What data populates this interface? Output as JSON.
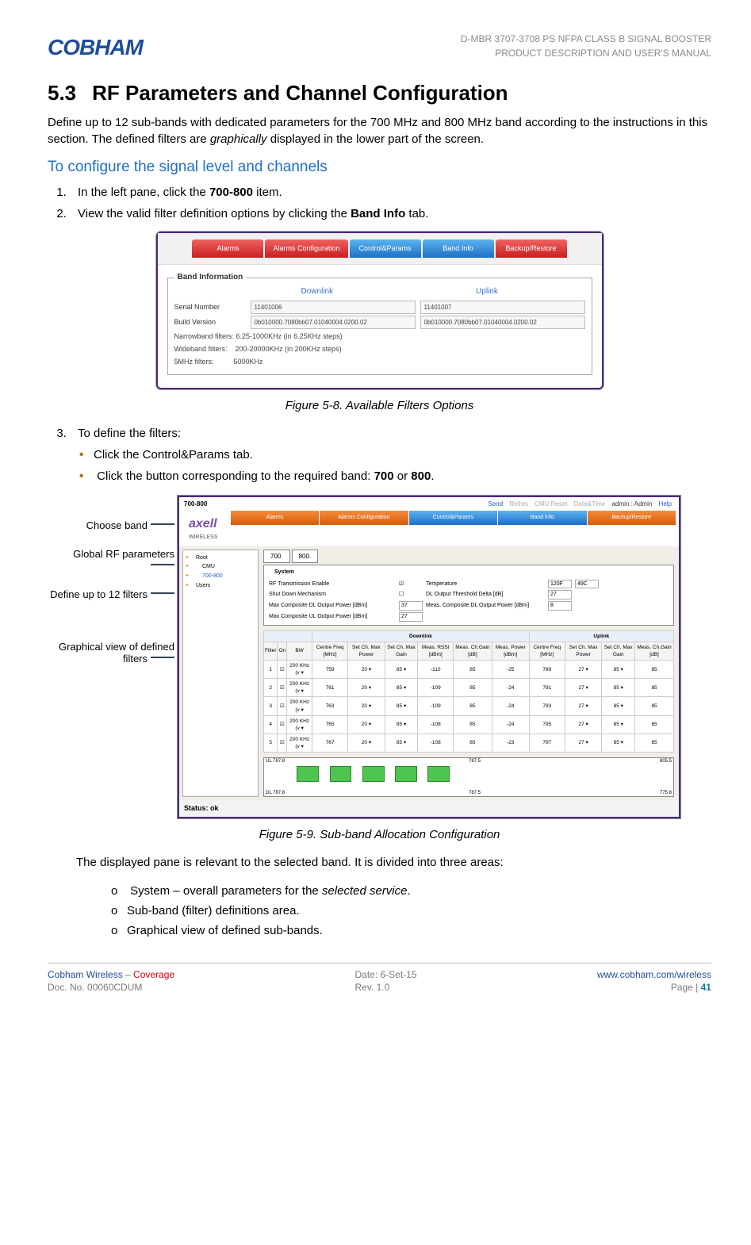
{
  "logo_text": "COBHAM",
  "header_right": {
    "line1": "D-MBR 3707-3708 PS NFPA CLASS B SIGNAL BOOSTER",
    "line2": "PRODUCT DESCRIPTION AND USER'S MANUAL"
  },
  "section": {
    "number": "5.3",
    "title": "RF Parameters and Channel Configuration"
  },
  "intro_before": "Define up to 12 sub-bands with dedicated parameters for the 700 MHz and 800 MHz band according to the instructions in this section. The defined filters are ",
  "intro_italic": "graphically",
  "intro_after": " displayed in the lower part of the screen.",
  "subhead": "To configure the signal level and channels",
  "steps": {
    "s1a": "In the left pane, click the ",
    "s1b": "700-800",
    "s1c": " item.",
    "s2a": "View the valid filter definition options by clicking the ",
    "s2b": "Band Info",
    "s2c": " tab.",
    "s3": "To define the filters:"
  },
  "fig1_caption": "Figure 5-8. Available Filters Options",
  "ui1": {
    "tabs": {
      "alarms": "Alarms",
      "alarms_cfg": "Alarms Configuration",
      "ctrl": "Control&Params",
      "band": "Band Info",
      "backup": "Backup/Restore"
    },
    "panel_title": "Band Information",
    "dl": "Downlink",
    "ul": "Uplink",
    "serial_label": "Serial Number",
    "serial_dl": "11401006",
    "serial_ul": "11401007",
    "build_label": "Build Version",
    "build_dl": "0b010000.7080bb07.01040004.0200.02",
    "build_ul": "0b010000.7080bb07.01040004.0200.02",
    "note1": "Narrowband filters: 6.25-1000KHz (in 6.25KHz steps)",
    "note2": "Wideband filters:    200-20000KHz (in 200KHz steps)",
    "note3": "5MHz filters:          5000KHz"
  },
  "bullets": {
    "b1": "Click the Control&Params tab.",
    "b2a": "Click the button corresponding to the required band: ",
    "b2b": "700",
    "b2or": " or ",
    "b2c": "800",
    "b2d": "."
  },
  "callouts": {
    "c1": "Choose band",
    "c2": "Global RF parameters",
    "c3": "Define up to 12 filters",
    "c4": "Graphical view of defined filters"
  },
  "ui2": {
    "title": "700-800",
    "menu": {
      "send": "Send",
      "refres": "Refres",
      "cmu": "CMU Reset",
      "dt": "Date&Time",
      "admin": "admin : Admin",
      "help": "Help"
    },
    "brand": "axell",
    "tabs": {
      "alarms": "Alarms",
      "alarms_cfg": "Alarms Configuration",
      "ctrl": "Control&Params",
      "band": "Band Info",
      "backup": "Backup/Restore"
    },
    "tree": {
      "root": "Root",
      "cmu": "CMU",
      "band": "700-800",
      "users": "Users"
    },
    "band_tabs": {
      "t700": "700.",
      "t800": "800."
    },
    "system": {
      "legend": "System",
      "rf_en": "RF Transmission Enable",
      "sd": "Shut Down Mechanism",
      "maxdl": "Max Composite DL Output Power [dBm]",
      "maxdl_v": "37",
      "maxul": "Max Composite UL Output Power [dBm]",
      "maxul_v": "27",
      "temp": "Temperature",
      "temp_f": "120F",
      "temp_c": "49C",
      "dlth": "DL Output Threshold Delta [dB]",
      "dlth_v": "27",
      "meas": "Meas. Composite DL Output Power [dBm]",
      "meas_v": "8"
    },
    "table": {
      "dl": "Downlink",
      "ul": "Uplink",
      "h_filter": "Filter",
      "h_on": "On",
      "h_bw": "BW",
      "h_cf": "Centre Freq [MHz]",
      "h_smp": "Set Ch. Max Power",
      "h_smg": "Set Ch. Max Gain",
      "h_rssi": "Meas. RSSI [dBm]",
      "h_mcg": "Meas. Ch.Gain [dB]",
      "h_mpw": "Meas. Power [dBm]",
      "h_cf2": "Centre Freq [MHz]",
      "h_smp2": "Set Ch. Max Power",
      "h_smg2": "Set Ch. Max Gain",
      "h_mcg2": "Meas. Ch.Gain [dB]",
      "rows": [
        {
          "n": "1",
          "bw": "200 KHz (v",
          "cf": "759",
          "smp": "20",
          "smg": "85",
          "rssi": "-110",
          "mcg": "85",
          "mpw": "-25",
          "cf2": "789",
          "smp2": "27",
          "smg2": "85",
          "mcg2": "85"
        },
        {
          "n": "2",
          "bw": "200 KHz (v",
          "cf": "761",
          "smp": "20",
          "smg": "85",
          "rssi": "-109",
          "mcg": "85",
          "mpw": "-24",
          "cf2": "791",
          "smp2": "27",
          "smg2": "85",
          "mcg2": "85"
        },
        {
          "n": "3",
          "bw": "200 KHz (v",
          "cf": "763",
          "smp": "20",
          "smg": "85",
          "rssi": "-109",
          "mcg": "85",
          "mpw": "-24",
          "cf2": "793",
          "smp2": "27",
          "smg2": "85",
          "mcg2": "85"
        },
        {
          "n": "4",
          "bw": "200 KHz (v",
          "cf": "765",
          "smp": "20",
          "smg": "85",
          "rssi": "-108",
          "mcg": "85",
          "mpw": "-24",
          "cf2": "795",
          "smp2": "27",
          "smg2": "85",
          "mcg2": "85"
        },
        {
          "n": "5",
          "bw": "200 KHz (v",
          "cf": "767",
          "smp": "20",
          "smg": "85",
          "rssi": "-108",
          "mcg": "85",
          "mpw": "-23",
          "cf2": "797",
          "smp2": "27",
          "smg2": "85",
          "mcg2": "85"
        }
      ],
      "ul_left": "UL 787.8",
      "ul_mid": "787.5",
      "ul_right": "805.5",
      "dl_left": "DL 787.8",
      "dl_mid": "787.5",
      "dl_right": "775.8"
    },
    "status": "Status: ok"
  },
  "fig2_caption": "Figure 5-9. Sub-band Allocation Configuration",
  "after_fig2": "The displayed pane is relevant to the selected band.  It is divided into three areas:",
  "sub_o": {
    "o1a": "System – overall parameters for the ",
    "o1b": "selected service",
    "o1c": ".",
    "o2": "Sub-band (filter) definitions area.",
    "o3": "Graphical view of defined sub-bands."
  },
  "footer": {
    "l1a": "Cobham Wireless",
    "l1b": " – ",
    "l1c": "Coverage",
    "l2": "Doc. No. 00060CDUM",
    "m1": "Date: 6-Set-15",
    "m2": "Rev. 1.0",
    "r1": "www.cobham.com/wireless",
    "r2a": "Page | ",
    "r2b": "41"
  }
}
